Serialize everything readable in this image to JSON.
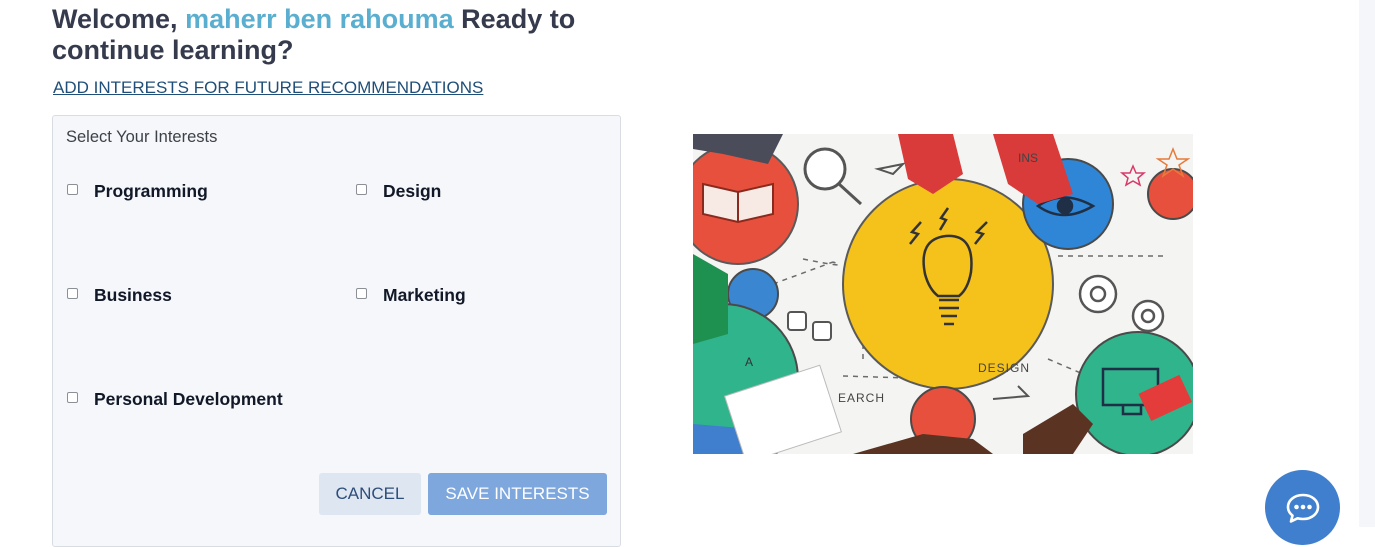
{
  "header": {
    "greeting": "Welcome,",
    "user_name": "maherr ben rahouma",
    "greeting_suffix": "Ready to continue learning?"
  },
  "add_interests_link": "ADD INTERESTS FOR FUTURE RECOMMENDATIONS",
  "interests_panel": {
    "title": "Select Your Interests",
    "options": [
      {
        "label": "Programming",
        "checked": false
      },
      {
        "label": "Design",
        "checked": false
      },
      {
        "label": "Business",
        "checked": false
      },
      {
        "label": "Marketing",
        "checked": false
      },
      {
        "label": "Personal Development",
        "checked": false
      }
    ],
    "cancel_label": "CANCEL",
    "save_label": "SAVE INTERESTS"
  },
  "illustration": {
    "texts": [
      "INS",
      "DESIGN",
      "A",
      "EARCH"
    ]
  },
  "colors": {
    "user_name": "#5aafd0",
    "heading": "#353a4d",
    "link": "#1f4f78",
    "save_button": "#7ea7de",
    "cancel_button": "#dee6f2",
    "chat_button": "#3f7fce"
  },
  "icons": {
    "chat": "chat-bubble-icon"
  }
}
